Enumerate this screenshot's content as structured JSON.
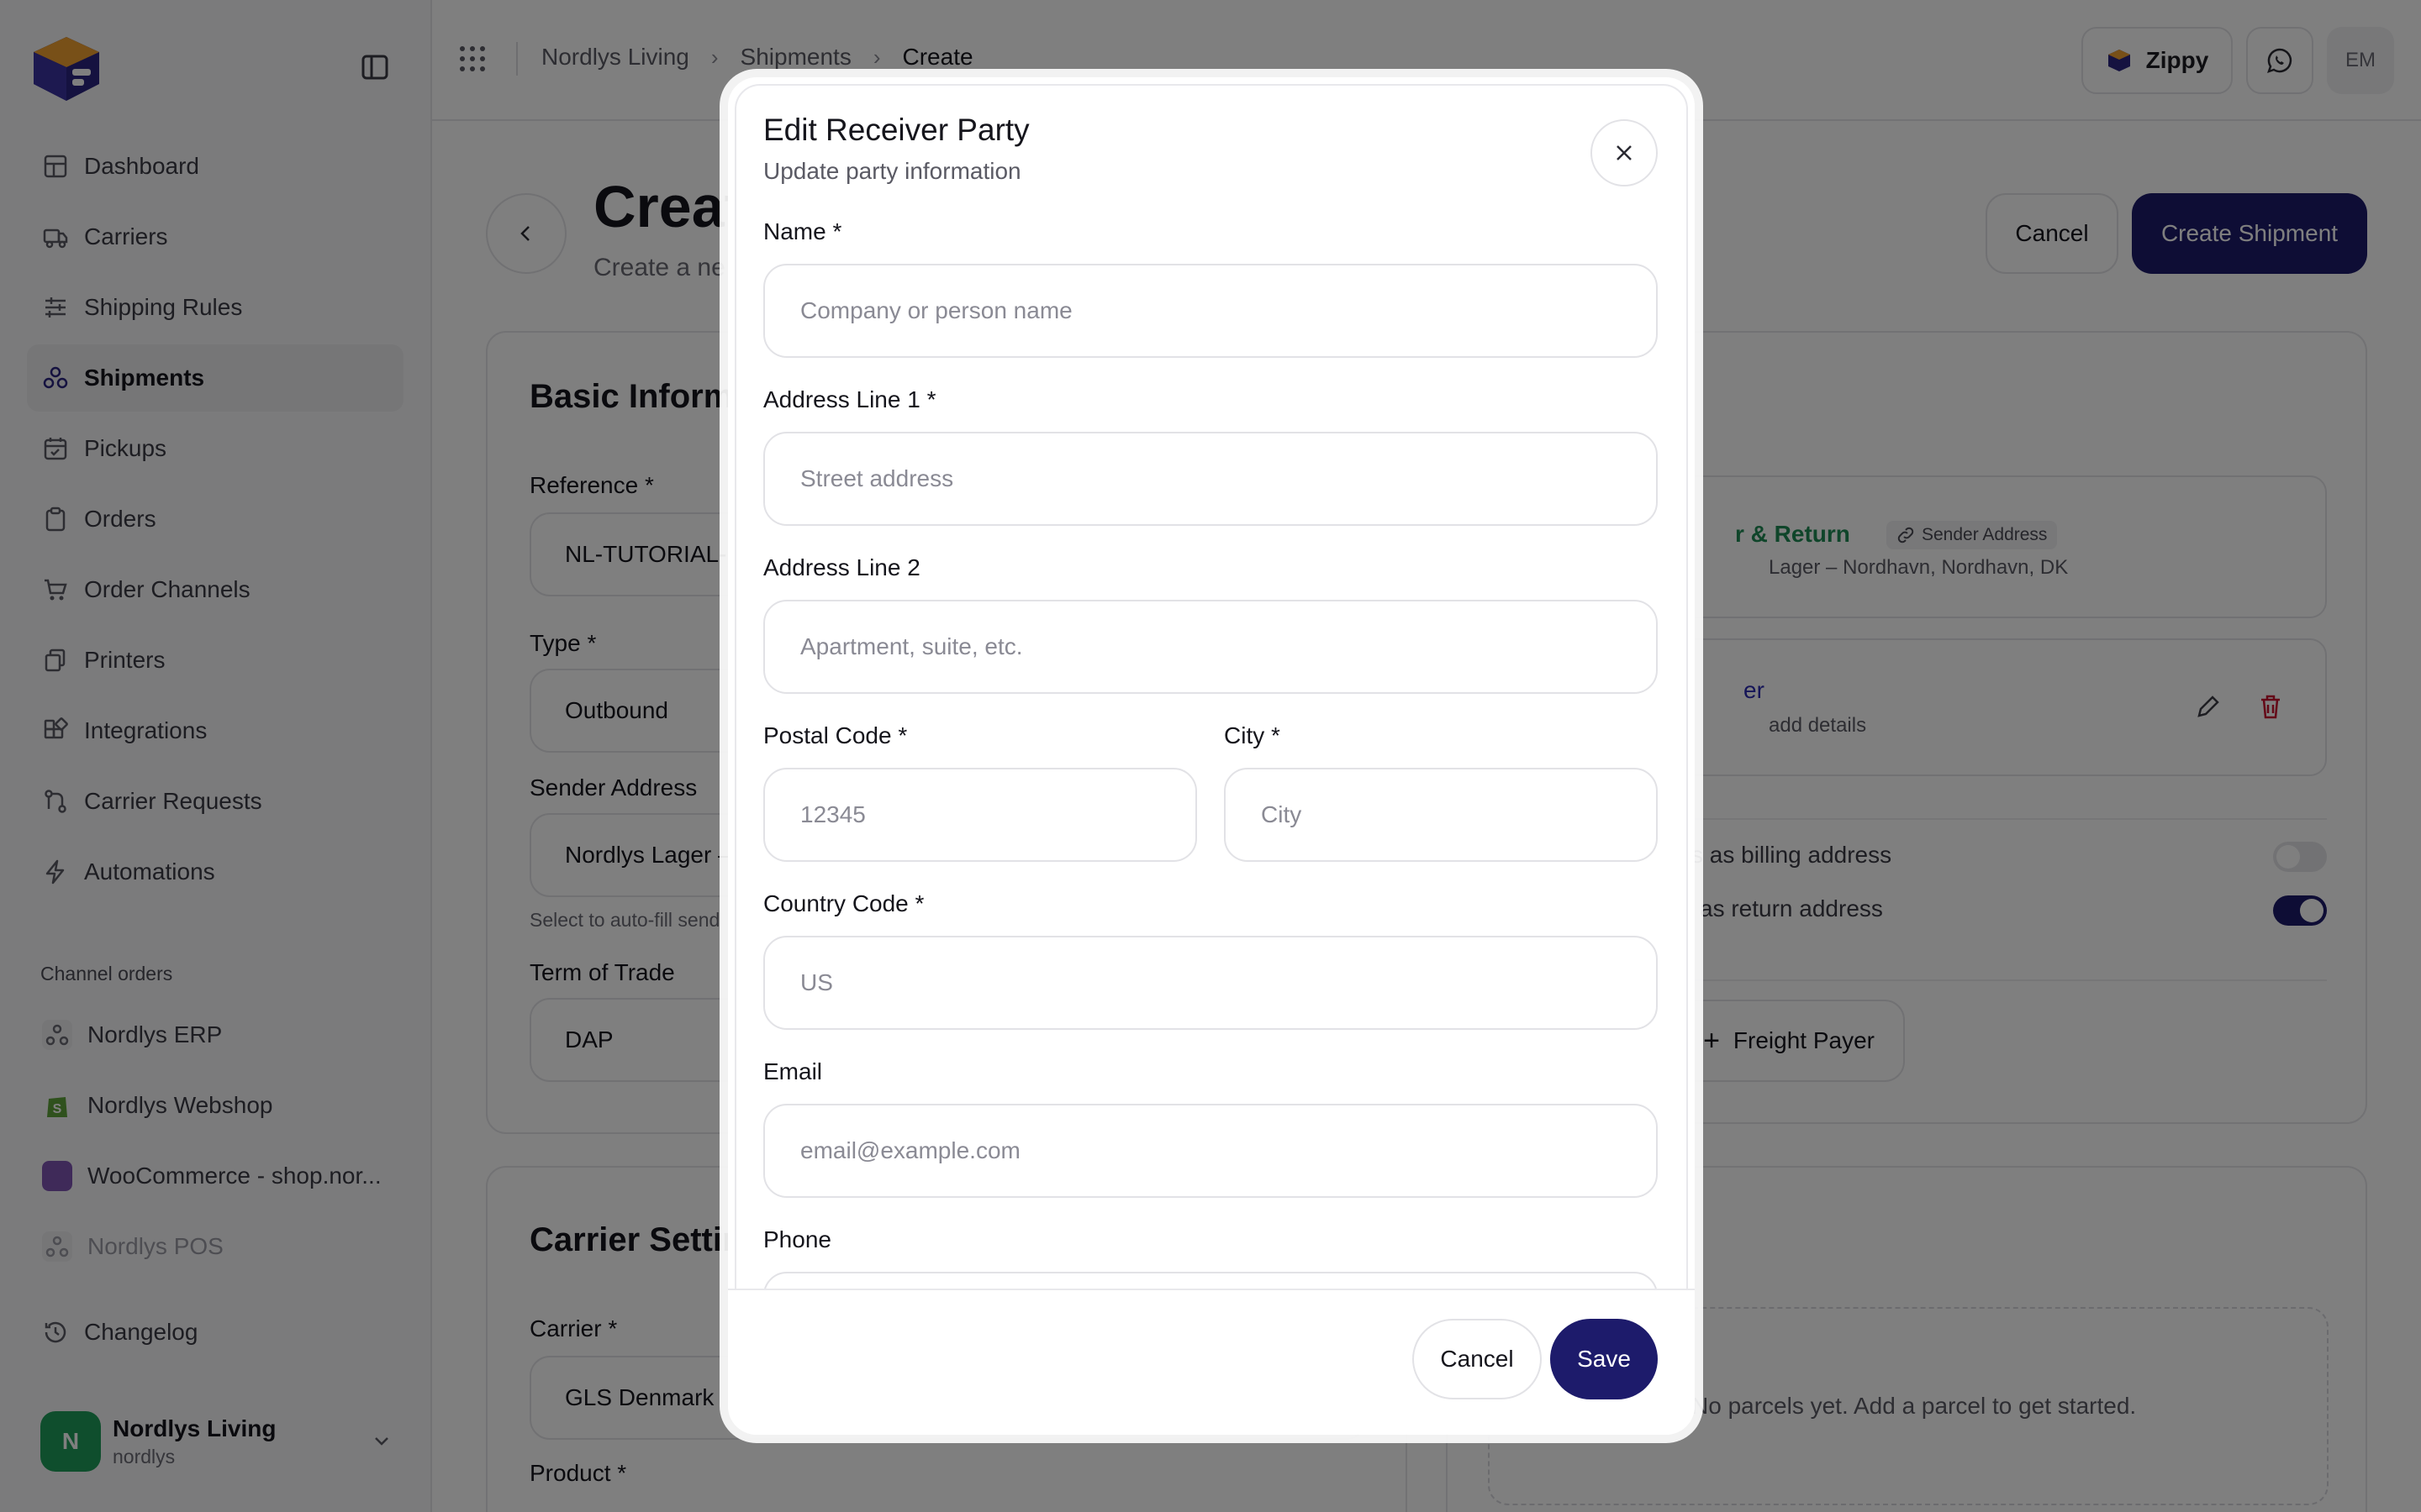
{
  "sidebar": {
    "items": [
      {
        "label": "Dashboard",
        "icon": "dashboard-icon"
      },
      {
        "label": "Carriers",
        "icon": "truck-icon"
      },
      {
        "label": "Shipping Rules",
        "icon": "sliders-icon"
      },
      {
        "label": "Shipments",
        "icon": "network-icon",
        "active": true
      },
      {
        "label": "Pickups",
        "icon": "calendar-icon"
      },
      {
        "label": "Orders",
        "icon": "clipboard-icon"
      },
      {
        "label": "Order Channels",
        "icon": "cart-icon"
      },
      {
        "label": "Printers",
        "icon": "printer-icon"
      },
      {
        "label": "Integrations",
        "icon": "puzzle-icon"
      },
      {
        "label": "Carrier Requests",
        "icon": "route-icon"
      },
      {
        "label": "Automations",
        "icon": "lightning-icon"
      }
    ],
    "channels_label": "Channel orders",
    "channels": [
      {
        "label": "Nordlys ERP",
        "icon": "webhook-icon"
      },
      {
        "label": "Nordlys Webshop",
        "icon": "shopify-icon"
      },
      {
        "label": "WooCommerce - shop.nor...",
        "icon": "woocommerce-icon"
      },
      {
        "label": "Nordlys POS",
        "icon": "webhook-icon"
      }
    ],
    "changelog": "Changelog",
    "account": {
      "initial": "N",
      "name": "Nordlys Living",
      "slug": "nordlys"
    }
  },
  "topbar": {
    "breadcrumb": [
      "Nordlys Living",
      "Shipments",
      "Create"
    ],
    "zippy": "Zippy",
    "user_initials": "EM"
  },
  "page": {
    "title": "Creat",
    "subtitle": "Create a ne",
    "cancel": "Cancel",
    "create": "Create Shipment"
  },
  "basic": {
    "title": "Basic Informa",
    "reference_label": "Reference *",
    "reference_value": "NL-TUTORIAL-(",
    "type_label": "Type *",
    "type_value": "Outbound",
    "sender_label": "Sender Address",
    "sender_value": "Nordlys Lager –",
    "sender_hint": "Select to auto-fill send",
    "term_label": "Term of Trade",
    "term_value": "DAP"
  },
  "carrier": {
    "title": "Carrier Settin",
    "carrier_label": "Carrier *",
    "carrier_value": "GLS Denmark",
    "product_label": "Product *"
  },
  "parties": {
    "sender_name": "r & Return",
    "sender_badge": "Sender Address",
    "sender_detail": "Lager – Nordhavn, Nordhavn, DK",
    "receiver_name": "er",
    "receiver_detail": "add details",
    "billing_text": "s as billing address",
    "billing_on": false,
    "return_text": "as return address",
    "return_on": true,
    "freight_payer": "Freight Payer"
  },
  "parcels": {
    "empty": "No parcels yet. Add a parcel to get started."
  },
  "modal": {
    "title": "Edit Receiver Party",
    "subtitle": "Update party information",
    "name_label": "Name *",
    "name_placeholder": "Company or person name",
    "addr1_label": "Address Line 1 *",
    "addr1_placeholder": "Street address",
    "addr2_label": "Address Line 2",
    "addr2_placeholder": "Apartment, suite, etc.",
    "postal_label": "Postal Code *",
    "postal_placeholder": "12345",
    "city_label": "City *",
    "city_placeholder": "City",
    "country_label": "Country Code *",
    "country_placeholder": "US",
    "email_label": "Email",
    "email_placeholder": "email@example.com",
    "phone_label": "Phone",
    "cancel": "Cancel",
    "save": "Save"
  },
  "colors": {
    "accent": "#1d1b6b",
    "success": "#1f9d5a",
    "danger": "#c8102e"
  }
}
